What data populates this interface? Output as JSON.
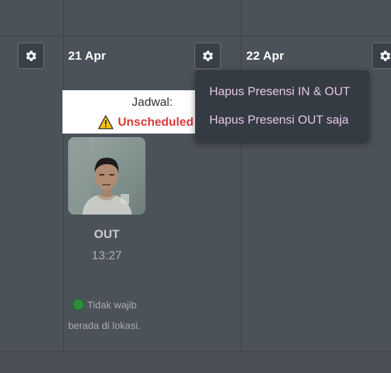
{
  "days": [
    {
      "date": "21 Apr"
    },
    {
      "date": "22 Apr"
    }
  ],
  "schedule": {
    "title": "Jadwal:",
    "status": "Unscheduled"
  },
  "attendance": {
    "type": "OUT",
    "time": "13:27",
    "location_note": "Tidak wajib berada di lokasi.",
    "location_status_color": "#2f8a3c"
  },
  "menu": {
    "items": [
      {
        "label": "Hapus Presensi IN & OUT"
      },
      {
        "label": "Hapus Presensi OUT saja"
      }
    ]
  },
  "icons": {
    "settings": "gear-icon",
    "warning": "warning-icon",
    "location_status": "status-dot-icon"
  },
  "colors": {
    "background": "#4b5259",
    "status_text": "#d93a3a",
    "menu_text": "#e6c6ea",
    "menu_bg": "#353b42"
  }
}
